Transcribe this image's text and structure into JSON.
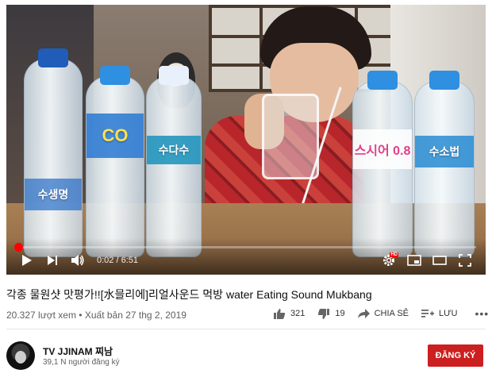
{
  "player": {
    "time_current": "0:02",
    "time_total": "6:51",
    "progress_fraction": 0.005,
    "buffered_fraction": 0.015,
    "hd_badge": "HD",
    "bottle_labels": [
      "수생명",
      "CO",
      "수다수",
      "스시어 0.8",
      "수소법"
    ]
  },
  "video": {
    "title": "각종 물원샷 맛평가!![水믈리에]리얼사운드 먹방 water Eating Sound Mukbang",
    "views": "20.327 lượt xem",
    "separator": "•",
    "published": "Xuất bản 27 thg 2, 2019"
  },
  "actions": {
    "likes": "321",
    "dislikes": "19",
    "share_label": "CHIA SẺ",
    "save_label": "LƯU",
    "more_label": "•••"
  },
  "channel": {
    "name": "TV JJINAM 찌남",
    "subscribers": "39,1 N người đăng ký",
    "subscribe_label": "ĐĂNG KÝ"
  },
  "colors": {
    "accent": "#ff0000",
    "subscribe_bg": "#cc1f1f",
    "text_secondary": "#606060"
  },
  "icons": [
    "play-icon",
    "next-icon",
    "volume-icon",
    "settings-icon",
    "miniplayer-icon",
    "theater-icon",
    "fullscreen-icon",
    "thumbs-up-icon",
    "thumbs-down-icon",
    "share-icon",
    "add-to-playlist-icon",
    "more-icon"
  ]
}
